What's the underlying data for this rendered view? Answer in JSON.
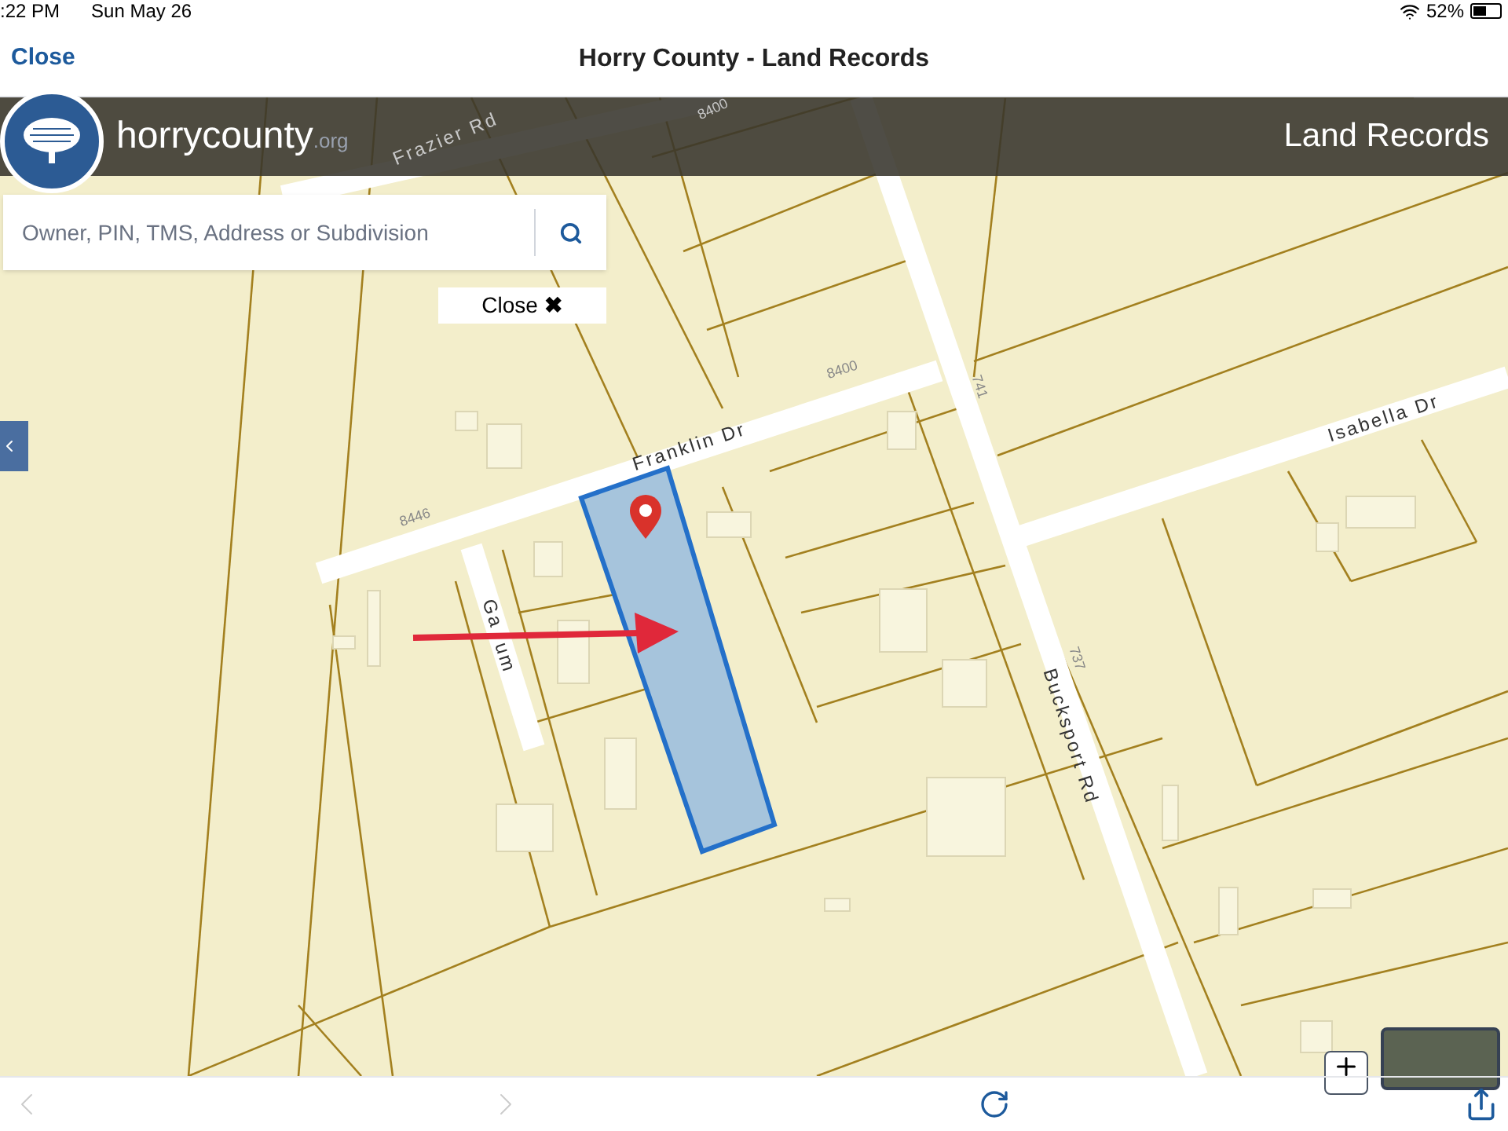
{
  "status_bar": {
    "time": ":22 PM",
    "date": "Sun May 26",
    "battery": "52%"
  },
  "nav_bar": {
    "close": "Close",
    "title": "Horry County - Land Records"
  },
  "header": {
    "logo_text": "horrycounty",
    "logo_suffix": ".org",
    "title": "Land Records"
  },
  "search": {
    "placeholder": "Owner, PIN, TMS, Address or Subdivision"
  },
  "close_button": {
    "label": "Close",
    "icon": "✖"
  },
  "map": {
    "labels": [
      {
        "text": "8400",
        "kind": "number"
      },
      {
        "text": "Frazier Rd",
        "kind": "street"
      },
      {
        "text": "8400",
        "kind": "number"
      },
      {
        "text": "Franklin Dr",
        "kind": "street"
      },
      {
        "text": "8446",
        "kind": "number"
      },
      {
        "text": "Ga",
        "kind": "street"
      },
      {
        "text": "um",
        "kind": "street"
      },
      {
        "text": "741",
        "kind": "number"
      },
      {
        "text": "737",
        "kind": "number"
      },
      {
        "text": "Bucksport Rd",
        "kind": "street"
      },
      {
        "text": "Isabella Dr",
        "kind": "street"
      }
    ]
  },
  "toolbar": {
    "back_disabled": true,
    "forward_disabled": true
  }
}
